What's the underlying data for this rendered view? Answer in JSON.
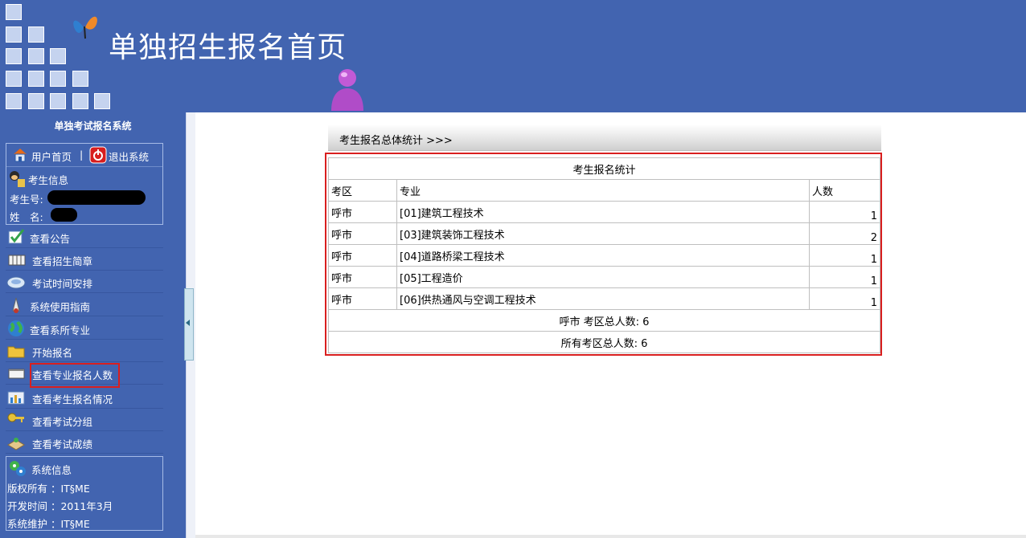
{
  "header": {
    "title": "单独招生报名首页"
  },
  "sidebar": {
    "system_name": "单独考试报名系统",
    "user_links": {
      "home": "用户首页",
      "separator": "|",
      "logout": "退出系统"
    },
    "candidate": {
      "section_title": "考生信息",
      "id_label": "考生号:",
      "name_label": "姓　名:"
    },
    "menu": [
      {
        "label": "查看公告",
        "icon": "notice-check-icon"
      },
      {
        "label": "查看招生简章",
        "icon": "brochure-icon"
      },
      {
        "label": "考试时间安排",
        "icon": "schedule-icon"
      },
      {
        "label": "系统使用指南",
        "icon": "guide-icon"
      },
      {
        "label": "查看系所专业",
        "icon": "globe-icon"
      },
      {
        "label": "开始报名",
        "icon": "folder-icon"
      },
      {
        "label": "查看专业报名人数",
        "icon": "window-icon"
      },
      {
        "label": "查看考生报名情况",
        "icon": "bar-chart-icon"
      },
      {
        "label": "查看考试分组",
        "icon": "keys-icon"
      },
      {
        "label": "查看考试成绩",
        "icon": "board-icon"
      }
    ],
    "system_info": {
      "title": "系统信息",
      "copyright": "版权所有 ：IT§ME",
      "dev_time": "开发时间 ：2011年3月",
      "maintainer": "系统维护 ：IT§ME"
    }
  },
  "main": {
    "breadcrumb": "考生报名总体统计 >>>",
    "table": {
      "title": "考生报名统计",
      "headers": [
        "考区",
        "专业",
        "人数"
      ],
      "rows": [
        [
          "呼市",
          "[01]建筑工程技术",
          "1"
        ],
        [
          "呼市",
          "[03]建筑装饰工程技术",
          "2"
        ],
        [
          "呼市",
          "[04]道路桥梁工程技术",
          "1"
        ],
        [
          "呼市",
          "[05]工程造价",
          "1"
        ],
        [
          "呼市",
          "[06]供热通风与空调工程技术",
          "1"
        ]
      ],
      "district_total": "呼市 考区总人数: 6",
      "overall_total": "所有考区总人数: 6"
    }
  },
  "colors": {
    "header_bg": "#4264b0",
    "highlight_border": "#d91f1f",
    "square": "#c5d3ef"
  }
}
